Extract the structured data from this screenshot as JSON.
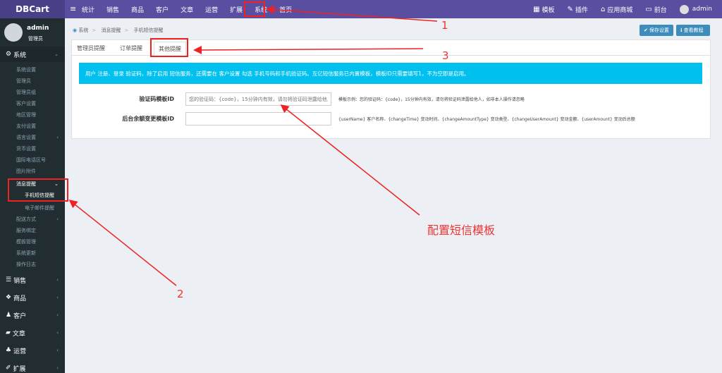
{
  "brand": "DBCart",
  "topnav": [
    "统计",
    "销售",
    "商品",
    "客户",
    "文章",
    "运营",
    "扩展",
    "系统",
    "首页"
  ],
  "topright": [
    {
      "icon": "grid-icon",
      "label": "模板"
    },
    {
      "icon": "plugin-icon",
      "label": "插件"
    },
    {
      "icon": "shop-icon",
      "label": "应用商城"
    },
    {
      "icon": "monitor-icon",
      "label": "前台"
    },
    {
      "icon": "avatar",
      "label": "admin"
    }
  ],
  "user": {
    "name": "admin",
    "role": "管理员"
  },
  "sidebar": {
    "system_head": "系统",
    "system_items": [
      "系统设置",
      "管理员",
      "管理员组",
      "客户设置",
      "地区管理",
      "支付设置",
      "语言设置",
      "货币设置",
      "国际电话区号",
      "图片附件"
    ],
    "msg_head": "消息提醒",
    "msg_active": "手机短信提醒",
    "msg_item2": "电子邮件提醒",
    "more_items": [
      "配送方式",
      "服务绑定",
      "模板管理",
      "系统更新",
      "操作日志"
    ],
    "groups": [
      "销售",
      "商品",
      "客户",
      "文章",
      "运营",
      "扩展"
    ]
  },
  "breadcrumb": [
    "系统",
    "消息提醒",
    "手机短信提醒"
  ],
  "buttons": {
    "save": "保存设置",
    "help": "查看教程"
  },
  "tabs": [
    "管理员提醒",
    "订单提醒",
    "其他提醒"
  ],
  "alert": "用户 注册、登录 验证码，除了启用 短信服务，还需要在 客户设置 勾选 手机号码和手机验证码。互亿短信服务已内置模板，模板ID只需要填写1，不为空即是启用。",
  "fields": [
    {
      "label": "验证码模板ID",
      "placeholder": "您的验证码：{code}，15分钟内有效，请勿将验证码泄露给他人，如非本人操作请忽略",
      "help": "模板示例：您的验证码：{code}，15分钟内有效，请勿将验证码泄露给他人，如非本人操作请忽略"
    },
    {
      "label": "后台余额变更模板ID",
      "placeholder": "",
      "help": "{userName} 客户名称、{changeTime} 变动时间、{changeAmountType} 变动类型、{changeUserAmount} 变动金额、{userAmount} 变动后总额"
    }
  ],
  "annotations": {
    "n1": "1",
    "n2": "2",
    "n3": "3",
    "note": "配置短信模板"
  },
  "colors": {
    "topbar": "#5a4ea0",
    "sidebar": "#222d32",
    "alert": "#00c0ef",
    "annotation": "#e22222",
    "button": "#3c8dbc"
  }
}
